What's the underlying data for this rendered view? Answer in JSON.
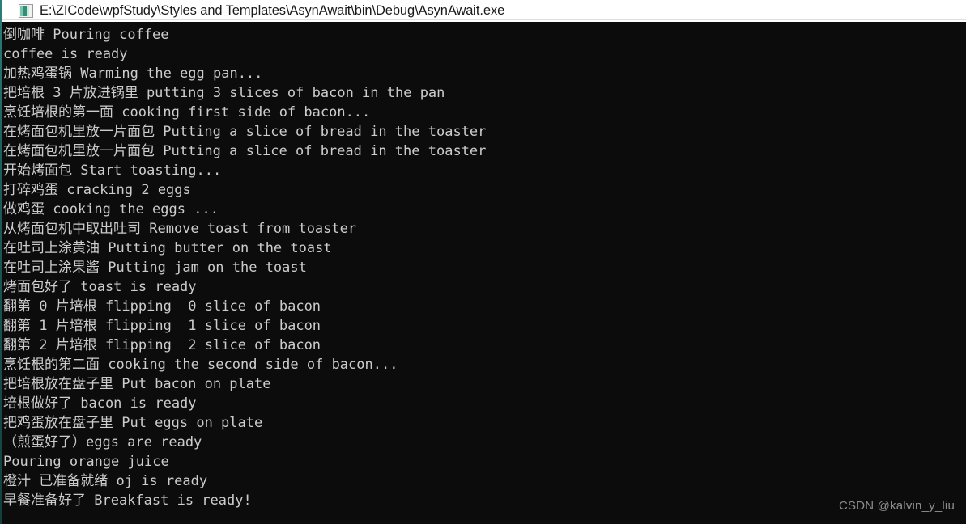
{
  "window": {
    "title": "E:\\ZICode\\wpfStudy\\Styles and Templates\\AsynAwait\\bin\\Debug\\AsynAwait.exe",
    "icon": "console-app-icon",
    "titlebar_background": "#ffffff",
    "titlebar_text_color": "#1a1a1a"
  },
  "console": {
    "background": "#0c0c0c",
    "text_color": "#cccccc",
    "font_size_px": 17,
    "line_height_px": 24,
    "lines": [
      "倒咖啡 Pouring coffee",
      "coffee is ready",
      "加热鸡蛋锅 Warming the egg pan...",
      "把培根 3 片放进锅里 putting 3 slices of bacon in the pan",
      "烹饪培根的第一面 cooking first side of bacon...",
      "在烤面包机里放一片面包 Putting a slice of bread in the toaster",
      "在烤面包机里放一片面包 Putting a slice of bread in the toaster",
      "开始烤面包 Start toasting...",
      "打碎鸡蛋 cracking 2 eggs",
      "做鸡蛋 cooking the eggs ...",
      "从烤面包机中取出吐司 Remove toast from toaster",
      "在吐司上涂黄油 Putting butter on the toast",
      "在吐司上涂果酱 Putting jam on the toast",
      "烤面包好了 toast is ready",
      "翻第 0 片培根 flipping  0 slice of bacon",
      "翻第 1 片培根 flipping  1 slice of bacon",
      "翻第 2 片培根 flipping  2 slice of bacon",
      "烹饪根的第二面 cooking the second side of bacon...",
      "把培根放在盘子里 Put bacon on plate",
      "培根做好了 bacon is ready",
      "把鸡蛋放在盘子里 Put eggs on plate",
      "（煎蛋好了）eggs are ready",
      "Pouring orange juice",
      "橙汁 已准备就绪 oj is ready",
      "早餐准备好了 Breakfast is ready!"
    ]
  },
  "watermark": {
    "text": "CSDN @kalvin_y_liu",
    "color": "#8d8d8d"
  }
}
